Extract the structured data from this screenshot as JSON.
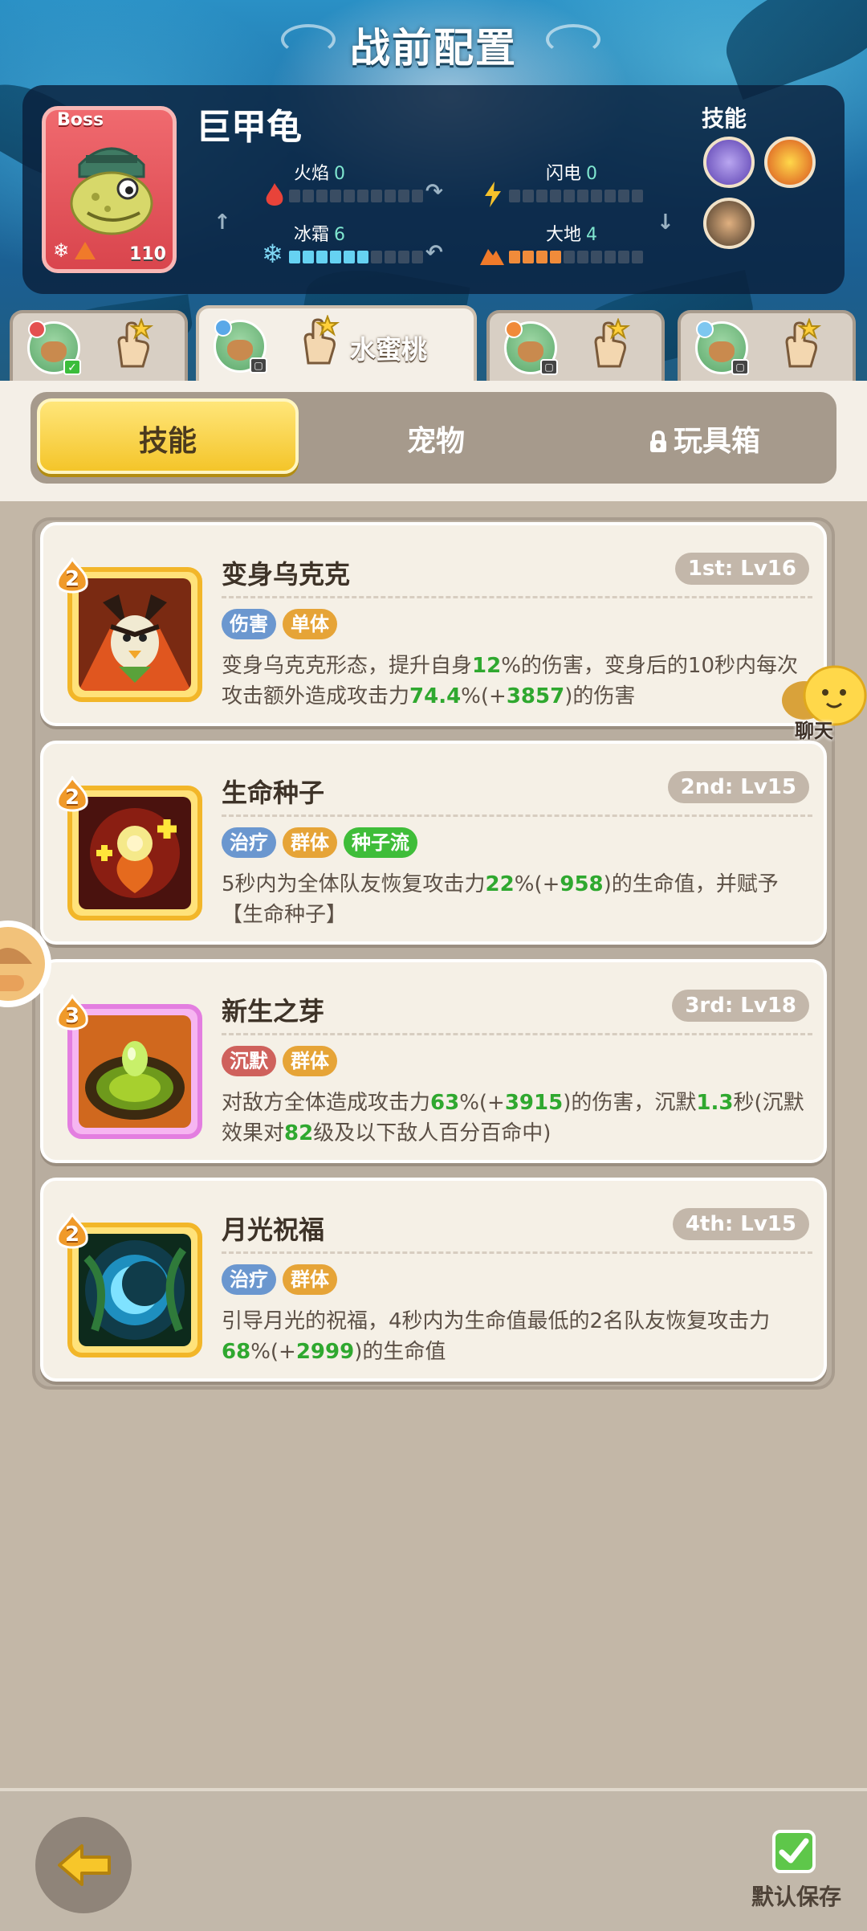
{
  "title": "战前配置",
  "boss": {
    "tag": "Boss",
    "name": "巨甲龟",
    "level": "110",
    "elements": {
      "fire": {
        "label": "火焰",
        "value": "0",
        "fill": 0
      },
      "lightning": {
        "label": "闪电",
        "value": "0",
        "fill": 0
      },
      "ice": {
        "label": "冰霜",
        "value": "6",
        "fill": 6
      },
      "earth": {
        "label": "大地",
        "value": "4",
        "fill": 4
      }
    },
    "skills_label": "技能",
    "skill_icons": [
      "purple-swirl-icon",
      "golden-crown-icon",
      "dark-beast-icon"
    ]
  },
  "team_tabs": [
    {
      "name": "",
      "active": false
    },
    {
      "name": "水蜜桃",
      "active": true
    },
    {
      "name": "",
      "active": false
    },
    {
      "name": "",
      "active": false
    }
  ],
  "segments": {
    "skills": "技能",
    "pets": "宠物",
    "toys": "玩具箱",
    "active": "skills"
  },
  "skills": [
    {
      "name": "变身乌克克",
      "rank": "1st: Lv16",
      "level": "2",
      "tags": [
        {
          "text": "伤害",
          "color": "blue"
        },
        {
          "text": "单体",
          "color": "yellow"
        }
      ],
      "desc_parts": [
        {
          "t": "变身乌克克形态，提升自身",
          "g": false
        },
        {
          "t": "12",
          "g": true
        },
        {
          "t": "%的伤害，变身后的10秒内每次攻击额外造成攻击力",
          "g": false
        },
        {
          "t": "74.4",
          "g": true
        },
        {
          "t": "%(+",
          "g": false
        },
        {
          "t": "3857",
          "g": true
        },
        {
          "t": ")的伤害",
          "g": false
        }
      ]
    },
    {
      "name": "生命种子",
      "rank": "2nd: Lv15",
      "level": "2",
      "tags": [
        {
          "text": "治疗",
          "color": "blue"
        },
        {
          "text": "群体",
          "color": "yellow"
        },
        {
          "text": "种子流",
          "color": "green"
        }
      ],
      "desc_parts": [
        {
          "t": "5秒内为全体队友恢复攻击力",
          "g": false
        },
        {
          "t": "22",
          "g": true
        },
        {
          "t": "%(+",
          "g": false
        },
        {
          "t": "958",
          "g": true
        },
        {
          "t": ")的生命值，并赋予【生命种子】",
          "g": false
        }
      ]
    },
    {
      "name": "新生之芽",
      "rank": "3rd: Lv18",
      "level": "3",
      "tags": [
        {
          "text": "沉默",
          "color": "red"
        },
        {
          "text": "群体",
          "color": "yellow"
        }
      ],
      "desc_parts": [
        {
          "t": "对敌方全体造成攻击力",
          "g": false
        },
        {
          "t": "63",
          "g": true
        },
        {
          "t": "%(+",
          "g": false
        },
        {
          "t": "3915",
          "g": true
        },
        {
          "t": ")的伤害，沉默",
          "g": false
        },
        {
          "t": "1.3",
          "g": true
        },
        {
          "t": "秒(沉默效果对",
          "g": false
        },
        {
          "t": "82",
          "g": true
        },
        {
          "t": "级及以下敌人百分百命中)",
          "g": false
        }
      ]
    },
    {
      "name": "月光祝福",
      "rank": "4th: Lv15",
      "level": "2",
      "tags": [
        {
          "text": "治疗",
          "color": "blue"
        },
        {
          "text": "群体",
          "color": "yellow"
        }
      ],
      "desc_parts": [
        {
          "t": "引导月光的祝福，4秒内为生命值最低的2名队友恢复攻击力",
          "g": false
        },
        {
          "t": "68",
          "g": true
        },
        {
          "t": "%(+",
          "g": false
        },
        {
          "t": "2999",
          "g": true
        },
        {
          "t": ")的生命值",
          "g": false
        }
      ]
    }
  ],
  "chat_label": "聊天",
  "save_label": "默认保存"
}
